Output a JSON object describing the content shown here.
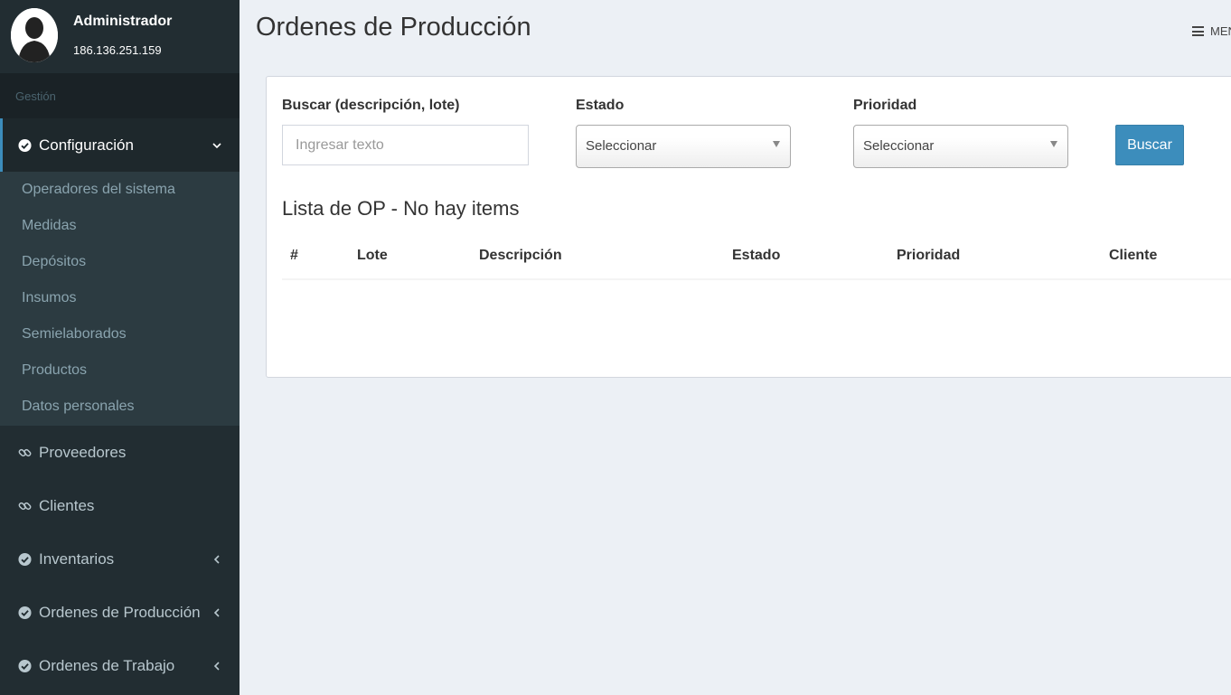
{
  "user": {
    "name": "Administrador",
    "ip": "186.136.251.159"
  },
  "sidebar": {
    "section_header": "Gestión",
    "active_item": {
      "label": "Configuración"
    },
    "submenu": [
      "Operadores del sistema",
      "Medidas",
      "Depósitos",
      "Insumos",
      "Semielaborados",
      "Productos",
      "Datos personales"
    ],
    "items": [
      {
        "label": "Proveedores",
        "icon": "link-icon"
      },
      {
        "label": "Clientes",
        "icon": "link-icon"
      },
      {
        "label": "Inventarios",
        "icon": "check-circle-icon"
      },
      {
        "label": "Ordenes de Producción",
        "icon": "check-circle-icon"
      },
      {
        "label": "Ordenes de Trabajo",
        "icon": "check-circle-icon"
      }
    ]
  },
  "header": {
    "title": "Ordenes de Producción",
    "menu_label": "MENU"
  },
  "filters": {
    "search_label": "Buscar (descripción, lote)",
    "search_placeholder": "Ingresar texto",
    "estado_label": "Estado",
    "estado_value": "Seleccionar",
    "prioridad_label": "Prioridad",
    "prioridad_value": "Seleccionar",
    "search_button": "Buscar"
  },
  "list": {
    "title": "Lista de OP - No hay items",
    "columns": [
      "#",
      "Lote",
      "Descripción",
      "Estado",
      "Prioridad",
      "Cliente"
    ],
    "rows": []
  },
  "colors": {
    "sidebar_bg": "#222d32",
    "accent": "#3c8dbc",
    "page_bg": "#ecf0f5"
  }
}
